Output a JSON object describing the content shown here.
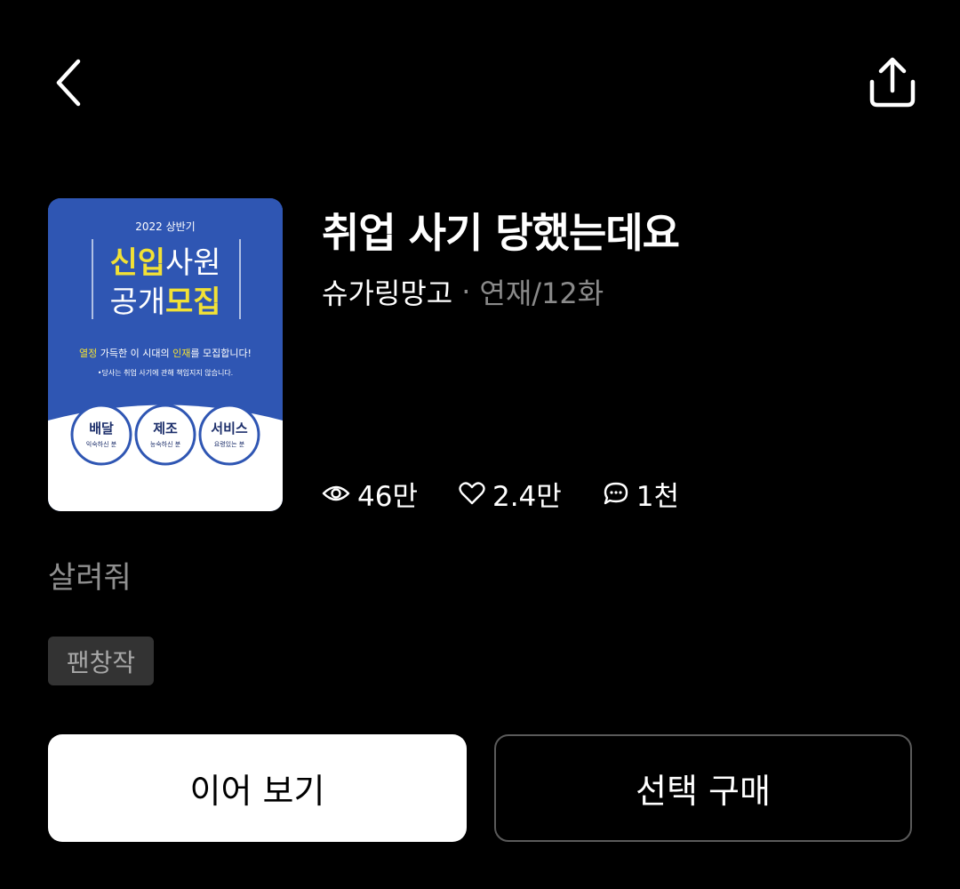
{
  "header": {
    "back_icon": "chevron-left-icon",
    "share_icon": "share-upload-icon"
  },
  "cover": {
    "year_label": "2022 상반기",
    "line1_a": "신입",
    "line1_b": "사원",
    "line2_a": "공개",
    "line2_b": "모집",
    "slogan_a": "열정",
    "slogan_b": " 가득한 이 시대의 ",
    "slogan_c": "인재",
    "slogan_d": "를 모집합니다!",
    "disclaimer": "•당사는 취업 사기에 관해 책임지지 않습니다.",
    "circles": [
      {
        "title": "배달",
        "sub": "익숙하신 분"
      },
      {
        "title": "제조",
        "sub": "능숙하신 분"
      },
      {
        "title": "서비스",
        "sub": "요령있는 분"
      }
    ],
    "colors": {
      "blue": "#2f56b3",
      "yellow": "#f2e135",
      "white": "#ffffff"
    }
  },
  "info": {
    "title": "취업 사기 당했는데요",
    "author": "슈가링망고",
    "separator": "·",
    "status": "연재/12화"
  },
  "stats": {
    "views": "46만",
    "likes": "2.4만",
    "comments": "1천",
    "icons": [
      "eye-icon",
      "heart-icon",
      "comment-icon"
    ]
  },
  "synopsis": "살려줘",
  "badge": "팬창작",
  "actions": {
    "continue_label": "이어 보기",
    "purchase_label": "선택 구매"
  }
}
